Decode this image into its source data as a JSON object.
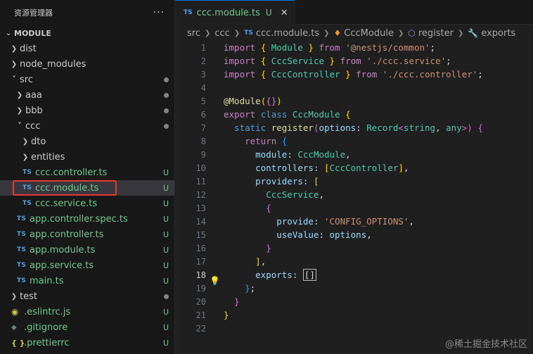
{
  "sidebar": {
    "title": "资源管理器",
    "more": "···",
    "section": "MODULE",
    "items": [
      {
        "label": "dist",
        "depth": 0,
        "kind": "folder",
        "open": false,
        "style": "plain",
        "status": ""
      },
      {
        "label": "node_modules",
        "depth": 0,
        "kind": "folder",
        "open": false,
        "style": "plain",
        "status": ""
      },
      {
        "label": "src",
        "depth": 0,
        "kind": "folder",
        "open": true,
        "style": "plain",
        "status": "dot"
      },
      {
        "label": "aaa",
        "depth": 1,
        "kind": "folder",
        "open": false,
        "style": "plain",
        "status": "dot"
      },
      {
        "label": "bbb",
        "depth": 1,
        "kind": "folder",
        "open": false,
        "style": "plain",
        "status": "dot"
      },
      {
        "label": "ccc",
        "depth": 1,
        "kind": "folder",
        "open": true,
        "style": "plain",
        "status": "dot"
      },
      {
        "label": "dto",
        "depth": 2,
        "kind": "folder",
        "open": false,
        "style": "plain",
        "status": ""
      },
      {
        "label": "entities",
        "depth": 2,
        "kind": "folder",
        "open": false,
        "style": "plain",
        "status": ""
      },
      {
        "label": "ccc.controller.ts",
        "depth": 2,
        "kind": "ts",
        "style": "mod",
        "status": "U"
      },
      {
        "label": "ccc.module.ts",
        "depth": 2,
        "kind": "ts",
        "style": "mod",
        "status": "U",
        "selected": true
      },
      {
        "label": "ccc.service.ts",
        "depth": 2,
        "kind": "ts",
        "style": "mod",
        "status": "U"
      },
      {
        "label": "app.controller.spec.ts",
        "depth": 1,
        "kind": "ts",
        "style": "mod",
        "status": "U"
      },
      {
        "label": "app.controller.ts",
        "depth": 1,
        "kind": "ts",
        "style": "mod",
        "status": "U"
      },
      {
        "label": "app.module.ts",
        "depth": 1,
        "kind": "ts",
        "style": "mod",
        "status": "U"
      },
      {
        "label": "app.service.ts",
        "depth": 1,
        "kind": "ts",
        "style": "mod",
        "status": "U"
      },
      {
        "label": "main.ts",
        "depth": 1,
        "kind": "ts",
        "style": "mod",
        "status": "U"
      },
      {
        "label": "test",
        "depth": 0,
        "kind": "folder",
        "open": false,
        "style": "plain",
        "status": "dot"
      },
      {
        "label": ".eslintrc.js",
        "depth": 0,
        "kind": "js",
        "style": "mod",
        "status": "U"
      },
      {
        "label": ".gitignore",
        "depth": 0,
        "kind": "git",
        "style": "mod",
        "status": "U"
      },
      {
        "label": ".prettierrc",
        "depth": 0,
        "kind": "json",
        "style": "mod",
        "status": "U"
      }
    ]
  },
  "tab": {
    "badge": "TS",
    "name": "ccc.module.ts",
    "status": "U",
    "close": "✕"
  },
  "breadcrumb": {
    "parts": [
      "src",
      "ccc",
      "ccc.module.ts",
      "CccModule",
      "register",
      "exports"
    ]
  },
  "editor": {
    "current_line": 18,
    "lines": [
      [
        [
          "import ",
          "kw"
        ],
        [
          "{ ",
          "p1"
        ],
        [
          "Module",
          "type"
        ],
        [
          " } ",
          "p1"
        ],
        [
          "from ",
          "kw"
        ],
        [
          "'@nestjs/common'",
          "str"
        ],
        [
          ";",
          "pun"
        ]
      ],
      [
        [
          "import ",
          "kw"
        ],
        [
          "{ ",
          "p1"
        ],
        [
          "CccService",
          "type"
        ],
        [
          " } ",
          "p1"
        ],
        [
          "from ",
          "kw"
        ],
        [
          "'./ccc.service'",
          "str"
        ],
        [
          ";",
          "pun"
        ]
      ],
      [
        [
          "import ",
          "kw"
        ],
        [
          "{ ",
          "p1"
        ],
        [
          "CccController",
          "type"
        ],
        [
          " } ",
          "p1"
        ],
        [
          "from ",
          "kw"
        ],
        [
          "'./ccc.controller'",
          "str"
        ],
        [
          ";",
          "pun"
        ]
      ],
      [],
      [
        [
          "@",
          "dec"
        ],
        [
          "Module",
          "dec"
        ],
        [
          "(",
          "p1"
        ],
        [
          "{}",
          "p2"
        ],
        [
          ")",
          "p1"
        ]
      ],
      [
        [
          "export ",
          "kw"
        ],
        [
          "class ",
          "kw"
        ],
        [
          "CccModule ",
          "type"
        ],
        [
          "{",
          "p1"
        ]
      ],
      [
        [
          "  static ",
          "kw"
        ],
        [
          "register",
          "fn"
        ],
        [
          "(",
          "p2"
        ],
        [
          "options",
          "param"
        ],
        [
          ": ",
          "pun"
        ],
        [
          "Record",
          "type"
        ],
        [
          "<",
          "p2"
        ],
        [
          "string",
          "type"
        ],
        [
          ", ",
          "pun"
        ],
        [
          "any",
          "type"
        ],
        [
          ">",
          "p2"
        ],
        [
          ") ",
          "p2"
        ],
        [
          "{",
          "p2"
        ]
      ],
      [
        [
          "    return ",
          "kw"
        ],
        [
          "{",
          "p3"
        ]
      ],
      [
        [
          "      module",
          "prop"
        ],
        [
          ": ",
          "pun"
        ],
        [
          "CccModule",
          "type"
        ],
        [
          ",",
          "pun"
        ]
      ],
      [
        [
          "      controllers",
          "prop"
        ],
        [
          ": ",
          "pun"
        ],
        [
          "[",
          "p1"
        ],
        [
          "CccController",
          "type"
        ],
        [
          "]",
          "p1"
        ],
        [
          ",",
          "pun"
        ]
      ],
      [
        [
          "      providers",
          "prop"
        ],
        [
          ": ",
          "pun"
        ],
        [
          "[",
          "p1"
        ]
      ],
      [
        [
          "        CccService",
          "type"
        ],
        [
          ",",
          "pun"
        ]
      ],
      [
        [
          "        {",
          "p2"
        ]
      ],
      [
        [
          "          provide",
          "prop"
        ],
        [
          ": ",
          "pun"
        ],
        [
          "'CONFIG_OPTIONS'",
          "str"
        ],
        [
          ",",
          "pun"
        ]
      ],
      [
        [
          "          useValue",
          "prop"
        ],
        [
          ": ",
          "pun"
        ],
        [
          "options",
          "param"
        ],
        [
          ",",
          "pun"
        ]
      ],
      [
        [
          "        }",
          "p2"
        ]
      ],
      [
        [
          "      ]",
          "p1"
        ],
        [
          ",",
          "pun"
        ]
      ],
      [
        [
          "      exports",
          "prop"
        ],
        [
          ": ",
          "pun"
        ],
        [
          "[]",
          "cursor"
        ]
      ],
      [
        [
          "    }",
          "p3"
        ],
        [
          ";",
          "pun"
        ]
      ],
      [
        [
          "  }",
          "p2"
        ]
      ],
      [
        [
          "}",
          "p1"
        ]
      ],
      []
    ]
  },
  "watermark": "@稀土掘金技术社区",
  "colors": {
    "kw": "#c586c0",
    "kwblue": "#569cd6",
    "type": "#4ec9b0",
    "str": "#ce9178",
    "pun": "#d4d4d4",
    "p1": "#ffd700",
    "p2": "#da70d6",
    "p3": "#179fff",
    "fn": "#dcdcaa",
    "param": "#9cdcfe",
    "prop": "#9cdcfe",
    "dec": "#dcdcaa",
    "mod": "#73c991"
  }
}
